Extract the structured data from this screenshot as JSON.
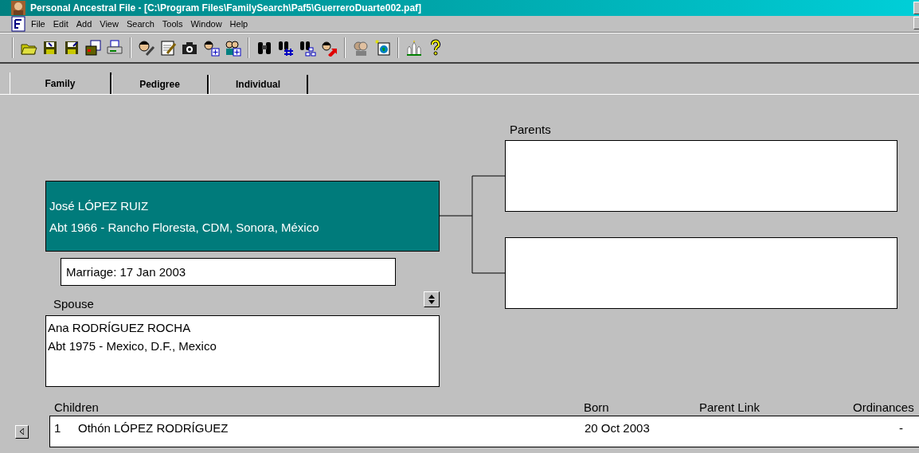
{
  "window": {
    "title": "Personal Ancestral File - [C:\\Program Files\\FamilySearch\\Paf5\\GuerreroDuarte002.paf]"
  },
  "menu": [
    "File",
    "Edit",
    "Add",
    "View",
    "Search",
    "Tools",
    "Window",
    "Help"
  ],
  "tabs": [
    {
      "label": "Family",
      "selected": true
    },
    {
      "label": "Pedigree",
      "selected": false
    },
    {
      "label": "Individual",
      "selected": false
    }
  ],
  "individual": {
    "name": "José LÓPEZ RUIZ",
    "detail": "Abt 1966 - Rancho Floresta, CDM, Sonora, México",
    "selected": true
  },
  "marriage": "Marriage: 17 Jan 2003",
  "spouse": {
    "label": "Spouse",
    "name": "Ana RODRÍGUEZ ROCHA",
    "detail": "Abt 1975 - Mexico, D.F., Mexico"
  },
  "parents": {
    "label": "Parents"
  },
  "children": {
    "columns": [
      "Children",
      "Born",
      "Parent Link",
      "Ordinances"
    ],
    "rows": [
      {
        "number": "1",
        "name": "Othón LÓPEZ RODRÍGUEZ",
        "born": "20 Oct 2003",
        "ordinances": "-"
      }
    ]
  }
}
